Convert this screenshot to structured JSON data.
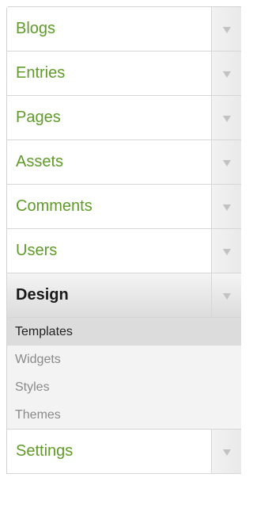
{
  "menu": {
    "items": [
      {
        "label": "Blogs"
      },
      {
        "label": "Entries"
      },
      {
        "label": "Pages"
      },
      {
        "label": "Assets"
      },
      {
        "label": "Comments"
      },
      {
        "label": "Users"
      },
      {
        "label": "Design"
      },
      {
        "label": "Settings"
      }
    ],
    "design_submenu": [
      {
        "label": "Templates"
      },
      {
        "label": "Widgets"
      },
      {
        "label": "Styles"
      },
      {
        "label": "Themes"
      }
    ],
    "toggle_icon": "chevron-down-icon",
    "colors": {
      "label": "#5f9b28",
      "active_label": "#1a1a1a",
      "submenu_bg": "#f3f3f3",
      "submenu_current_bg": "#dcdcdc"
    }
  }
}
